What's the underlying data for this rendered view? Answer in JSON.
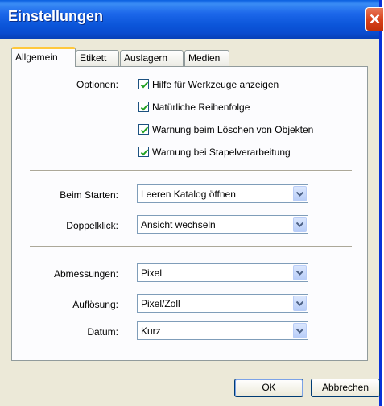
{
  "window": {
    "title": "Einstellungen"
  },
  "tabs": [
    "Allgemein",
    "Etikett",
    "Auslagern",
    "Medien"
  ],
  "options": {
    "label": "Optionen:",
    "checkboxes": [
      {
        "label": "Hilfe für Werkzeuge anzeigen",
        "checked": true
      },
      {
        "label": "Natürliche Reihenfolge",
        "checked": true
      },
      {
        "label": "Warnung beim Löschen von Objekten",
        "checked": true
      },
      {
        "label": "Warnung bei Stapelverarbeitung",
        "checked": true
      }
    ]
  },
  "startup": {
    "label": "Beim Starten:",
    "value": "Leeren Katalog öffnen"
  },
  "doubleclick": {
    "label": "Doppelklick:",
    "value": "Ansicht wechseln"
  },
  "dimensions": {
    "label": "Abmessungen:",
    "value": "Pixel"
  },
  "resolution": {
    "label": "Auflösung:",
    "value": "Pixel/Zoll"
  },
  "date": {
    "label": "Datum:",
    "value": "Kurz"
  },
  "buttons": {
    "ok": "OK",
    "cancel": "Abbrechen"
  },
  "colors": {
    "titlebar": "#0a55d9",
    "tab_highlight": "#ffc83c",
    "checkmark": "#21a121"
  }
}
